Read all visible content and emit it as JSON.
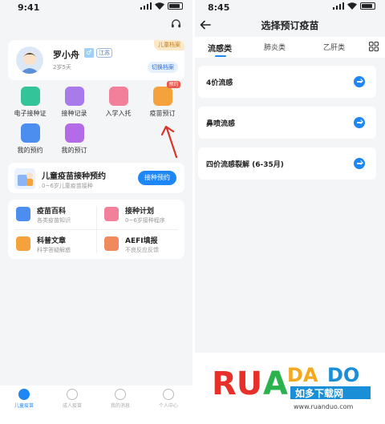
{
  "left": {
    "status_time": "9:41",
    "profile": {
      "name": "罗小舟",
      "gender_glyph": "♂",
      "region": "江苏",
      "age": "2岁5天",
      "archive_tag": "儿童档案",
      "switch_label": "切换档案"
    },
    "grid": [
      {
        "label": "电子接种证",
        "color": "#33c49a",
        "badge": ""
      },
      {
        "label": "接种记录",
        "color": "#a97bea",
        "badge": ""
      },
      {
        "label": "入学入托",
        "color": "#f2809a",
        "badge": ""
      },
      {
        "label": "疫苗预订",
        "color": "#f6a23c",
        "badge": "预约"
      },
      {
        "label": "我的预约",
        "color": "#4c8ef0",
        "badge": ""
      },
      {
        "label": "我的预订",
        "color": "#b36be8",
        "badge": ""
      }
    ],
    "banner": {
      "title": "儿童疫苗接种预约",
      "subtitle": "0~6岁儿童疫苗接种",
      "button": "接种预约"
    },
    "cards": [
      {
        "title": "疫苗百科",
        "subtitle": "各类疫苗知识",
        "color": "#4c8ef0"
      },
      {
        "title": "接种计划",
        "subtitle": "0~6岁接种程序",
        "color": "#f2809a"
      },
      {
        "title": "科普文章",
        "subtitle": "科学答疑解惑",
        "color": "#f6a23c"
      },
      {
        "title": "AEFI填报",
        "subtitle": "不良反应反馈",
        "color": "#f08a5d"
      }
    ],
    "tabs": [
      {
        "label": "儿童疫苗",
        "active": true
      },
      {
        "label": "成人疫苗",
        "active": false
      },
      {
        "label": "我的消息",
        "active": false
      },
      {
        "label": "个人中心",
        "active": false
      }
    ],
    "accent": "#1f86f5"
  },
  "right": {
    "status_time": "8:45",
    "title": "选择预订疫苗",
    "tabs": [
      "流感类",
      "肺炎类",
      "乙肝类"
    ],
    "active_tab": "流感类",
    "vaccines": [
      "4价流感",
      "鼻喷流感",
      "四价流感裂解 (6-35月)"
    ]
  },
  "watermark": {
    "logo_text": "RUANDADO",
    "cn_text": "如多下载网",
    "url": "www.ruanduo.com"
  }
}
